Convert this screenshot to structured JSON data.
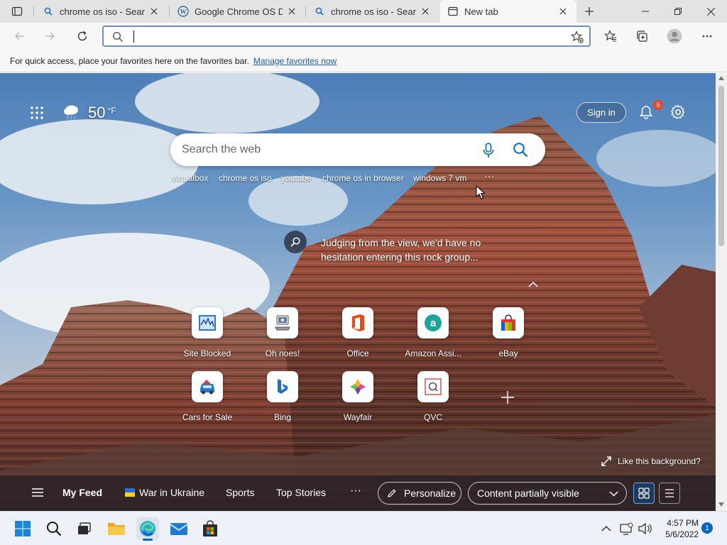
{
  "tabs": [
    {
      "title": "chrome os iso - Search",
      "icon": "search-icon"
    },
    {
      "title": "Google Chrome OS Dov",
      "icon": "wordpress-icon"
    },
    {
      "title": "chrome os iso - Search",
      "icon": "search-icon"
    },
    {
      "title": "New tab",
      "icon": "newtab-icon"
    }
  ],
  "address": {
    "value": "",
    "placeholder": ""
  },
  "favorites_bar": {
    "message": "For quick access, place your favorites here on the favorites bar.",
    "link": "Manage favorites now"
  },
  "weather": {
    "temp": "50",
    "unit": "°F"
  },
  "header": {
    "sign_in": "Sign in",
    "notification_count": "5"
  },
  "search": {
    "placeholder": "Search the web",
    "suggestions": [
      "virtualbox",
      "chrome os iso",
      "youtube",
      "chrome os in browser",
      "windows 7 vm"
    ],
    "more": "···"
  },
  "image_caption": {
    "line1": "Judging from the view, we'd have no",
    "line2": "hesitation entering this rock group..."
  },
  "tiles": [
    {
      "label": "Site Blocked"
    },
    {
      "label": "Oh noes!"
    },
    {
      "label": "Office"
    },
    {
      "label": "Amazon Assi..."
    },
    {
      "label": "eBay"
    },
    {
      "label": "Cars for Sale"
    },
    {
      "label": "Bing"
    },
    {
      "label": "Wayfair"
    },
    {
      "label": "QVC"
    }
  ],
  "like_bg": "Like this background?",
  "feed": {
    "my_feed": "My Feed",
    "war": "War in Ukraine",
    "sports": "Sports",
    "top_stories": "Top Stories",
    "more": "···",
    "personalize": "Personalize",
    "content_visibility": "Content partially visible"
  },
  "clock": {
    "time": "4:57 PM",
    "date": "5/6/2022",
    "notification_count": "1"
  },
  "colors": {
    "accent": "#0067c0",
    "tabstrip": "#e3e3e3",
    "toolbar": "#f7f7f7",
    "notification": "#e04a2f"
  }
}
